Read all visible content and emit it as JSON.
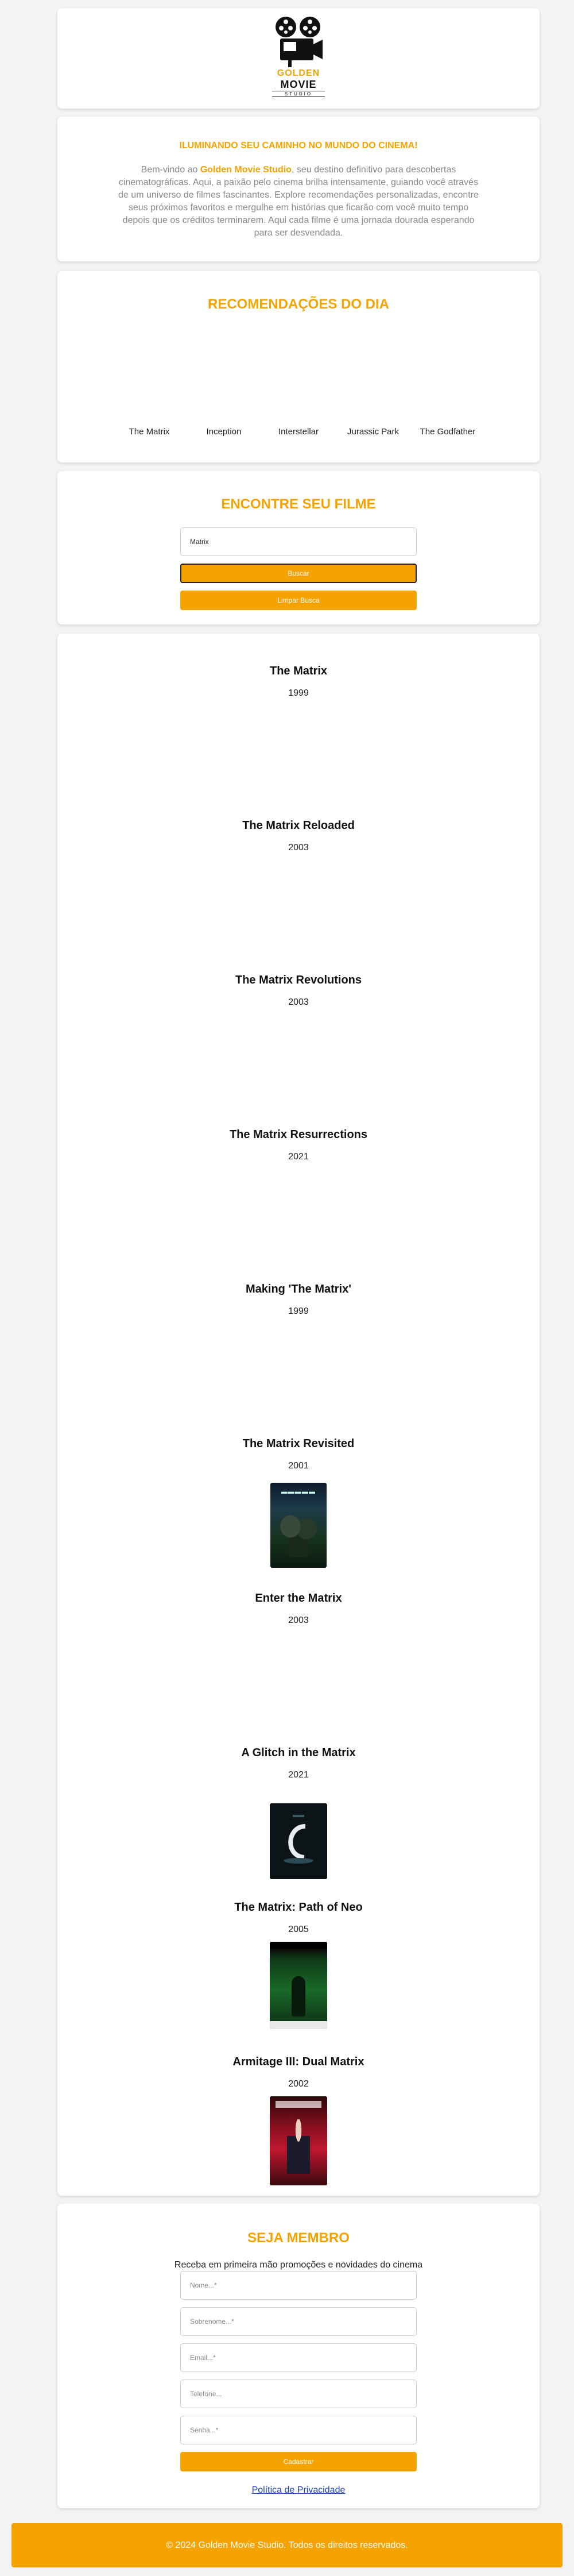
{
  "brand": {
    "logo_text_1": "GOLDEN",
    "logo_text_2": "MOVIE",
    "logo_text_3": "STUDIO",
    "accent_color": "#f5a300"
  },
  "intro": {
    "headline": "ILUMINANDO SEU CAMINHO NO MUNDO DO CINEMA!",
    "text_before": "Bem-vindo ao ",
    "brand_name": "Golden Movie Studio",
    "text_after": ", seu destino definitivo para descobertas cinematográficas. Aqui, a paixão pelo cinema brilha intensamente, guiando você através de um universo de filmes fascinantes. Explore recomendações personalizadas, encontre seus próximos favoritos e mergulhe em histórias que ficarão com você muito tempo depois que os créditos terminarem. Aqui cada filme é uma jornada dourada esperando para ser desvendada."
  },
  "recommendations": {
    "title": "RECOMENDAÇÕES DO DIA",
    "items": [
      "The Matrix",
      "Inception",
      "Interstellar",
      "Jurassic Park",
      "The Godfather"
    ]
  },
  "search": {
    "title": "ENCONTRE SEU FILME",
    "input_value": "Matrix",
    "search_button": "Buscar",
    "clear_button": "Limpar Busca"
  },
  "results": [
    {
      "title": "The Matrix",
      "year": "1999",
      "poster": ""
    },
    {
      "title": "The Matrix Reloaded",
      "year": "2003",
      "poster": ""
    },
    {
      "title": "The Matrix Revolutions",
      "year": "2003",
      "poster": ""
    },
    {
      "title": "The Matrix Resurrections",
      "year": "2021",
      "poster": ""
    },
    {
      "title": "Making 'The Matrix'",
      "year": "1999",
      "poster": ""
    },
    {
      "title": "The Matrix Revisited",
      "year": "2001",
      "poster": "matrix-revisited-poster"
    },
    {
      "title": "Enter the Matrix",
      "year": "2003",
      "poster": ""
    },
    {
      "title": "A Glitch in the Matrix",
      "year": "2021",
      "poster": "glitch-poster"
    },
    {
      "title": "The Matrix: Path of Neo",
      "year": "2005",
      "poster": "path-of-neo-poster"
    },
    {
      "title": "Armitage III: Dual Matrix",
      "year": "2002",
      "poster": "armitage-poster"
    }
  ],
  "member": {
    "title": "SEJA MEMBRO",
    "subtitle": "Receba em primeira mão promoções e novidades do cinema",
    "fields": [
      "Nome...*",
      "Sobrenome...*",
      "Email...*",
      "Telefone...",
      "Senha...*"
    ],
    "signup_button": "Cadastrar",
    "privacy_link": "Política de Privacidade"
  },
  "footer": {
    "text": "© 2024 Golden Movie Studio. Todos os direitos reservados."
  }
}
